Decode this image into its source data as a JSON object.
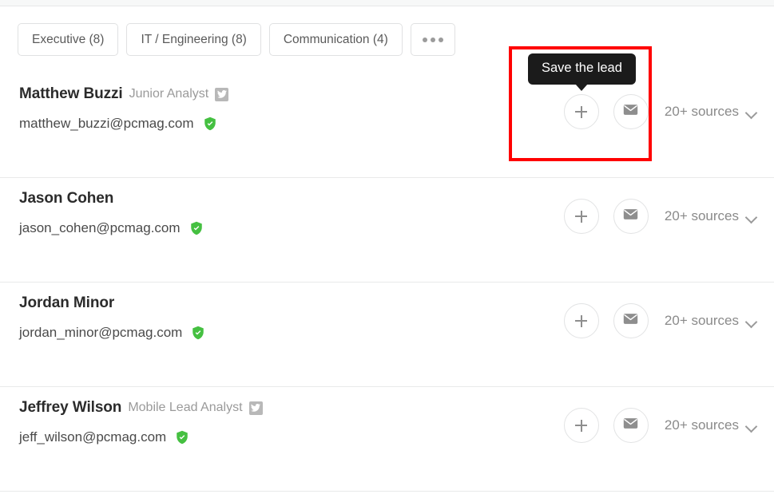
{
  "filters": {
    "pills": [
      {
        "label": "Executive (8)",
        "name": "filter-pill-executive"
      },
      {
        "label": "IT / Engineering (8)",
        "name": "filter-pill-it-engineering"
      },
      {
        "label": "Communication (4)",
        "name": "filter-pill-communication"
      }
    ],
    "more_label": "•••"
  },
  "tooltip": {
    "text": "Save the lead"
  },
  "contacts": [
    {
      "name": "Matthew Buzzi",
      "title": "Junior Analyst",
      "has_twitter": true,
      "email": "matthew_buzzi@pcmag.com",
      "verified": true,
      "sources_label": "20+ sources"
    },
    {
      "name": "Jason Cohen",
      "title": "",
      "has_twitter": false,
      "email": "jason_cohen@pcmag.com",
      "verified": true,
      "sources_label": "20+ sources"
    },
    {
      "name": "Jordan Minor",
      "title": "",
      "has_twitter": false,
      "email": "jordan_minor@pcmag.com",
      "verified": true,
      "sources_label": "20+ sources"
    },
    {
      "name": "Jeffrey Wilson",
      "title": "Mobile Lead Analyst",
      "has_twitter": true,
      "email": "jeff_wilson@pcmag.com",
      "verified": true,
      "sources_label": "20+ sources"
    }
  ],
  "icons": {
    "add": "plus-icon",
    "email": "envelope-icon",
    "twitter": "twitter-icon",
    "verified": "verified-shield-icon",
    "chevron": "chevron-down-icon"
  },
  "colors": {
    "verified_green": "#45c041",
    "tooltip_bg": "#1b1b1b",
    "highlight_red": "#ff0000",
    "twitter_gray": "#b8b8b8"
  }
}
